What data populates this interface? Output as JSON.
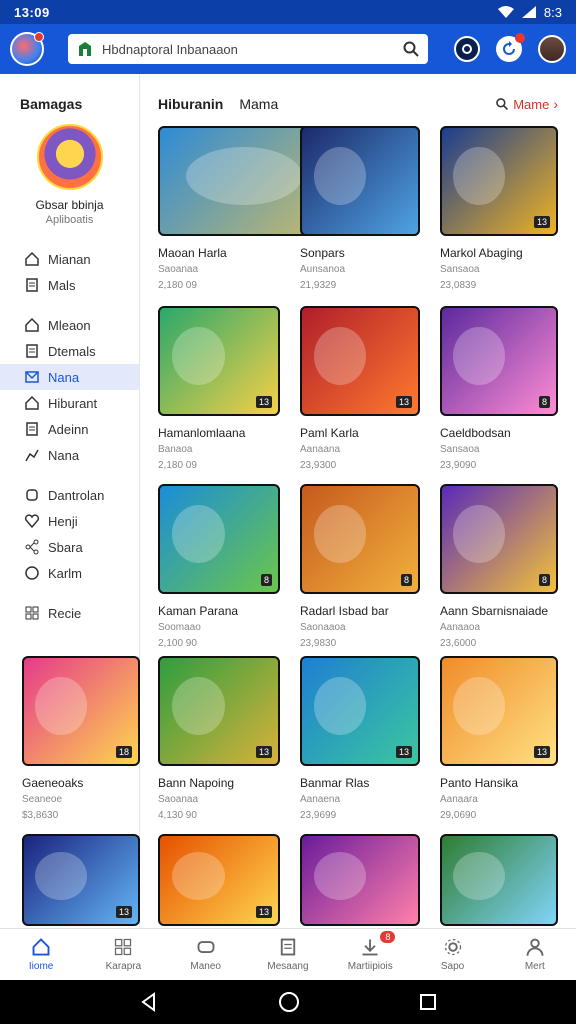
{
  "status": {
    "time": "13:09",
    "right": "8:3"
  },
  "search": {
    "value": "Hbdnaptoral Inbanaaon"
  },
  "sidebar": {
    "title": "Bamagas",
    "profile": {
      "name": "Gbsar bbinja",
      "sub": "Apliboatis"
    },
    "items": [
      {
        "label": "Mianan",
        "icon": "home-icon"
      },
      {
        "label": "Mals",
        "icon": "doc-icon"
      },
      {
        "label": "Mleaon",
        "icon": "home-icon"
      },
      {
        "label": "Dtemals",
        "icon": "doc-icon"
      },
      {
        "label": "Nana",
        "icon": "mail-icon",
        "active": true
      },
      {
        "label": "Hiburant",
        "icon": "home-icon"
      },
      {
        "label": "Adeinn",
        "icon": "doc-icon"
      },
      {
        "label": "Nana",
        "icon": "chart-icon"
      },
      {
        "label": "Dantrolan",
        "icon": "puzzle-icon"
      },
      {
        "label": "Henji",
        "icon": "heart-icon"
      },
      {
        "label": "Sbara",
        "icon": "share-icon"
      },
      {
        "label": "Karlm",
        "icon": "circle-icon"
      },
      {
        "label": "Recie",
        "icon": "grid-icon"
      }
    ]
  },
  "section": {
    "tab1": "Hiburanin",
    "tab2": "Mama",
    "more": "Mame"
  },
  "cards": [
    {
      "title": "Maoan Harla",
      "meta": "Saoanaa",
      "size": "2,180 09",
      "tag": "",
      "colors": [
        "#2e8bd6",
        "#f7c948"
      ]
    },
    {
      "title": "Sonpars",
      "meta": "Aunsanoa",
      "size": "21,9329",
      "tag": "",
      "colors": [
        "#1c2a6b",
        "#4fa3e3"
      ]
    },
    {
      "title": "Markol Abaging",
      "meta": "Sansaoa",
      "size": "23,0839",
      "tag": "13",
      "colors": [
        "#1b3d8f",
        "#f0b323"
      ]
    },
    {
      "title": "Hamanlomlaana",
      "meta": "Banaoa",
      "size": "2,180 09",
      "tag": "13",
      "colors": [
        "#2aa86b",
        "#f7d046"
      ]
    },
    {
      "title": "Paml Karla",
      "meta": "Aanaana",
      "size": "23,9300",
      "tag": "13",
      "colors": [
        "#b11e2b",
        "#ff7a2e"
      ]
    },
    {
      "title": "Caeldbodsan",
      "meta": "Sansaoa",
      "size": "23,9090",
      "tag": "8",
      "colors": [
        "#5b2a9e",
        "#ff8cd4"
      ]
    },
    {
      "title": "Kaman Parana",
      "meta": "Soomaao",
      "size": "2,100 90",
      "tag": "8",
      "colors": [
        "#1a8dd8",
        "#6cc64a"
      ]
    },
    {
      "title": "Radarl Isbad bar",
      "meta": "Saonaaoa",
      "size": "23,9830",
      "tag": "8",
      "colors": [
        "#c65a1e",
        "#f2b13d"
      ]
    },
    {
      "title": "Aann Sbarnisnaiade",
      "meta": "Aanaaoa",
      "size": "23,6000",
      "tag": "8",
      "colors": [
        "#5a2ab8",
        "#f3c13a"
      ]
    },
    {
      "title": "Gaeneoaks",
      "meta": "Seaneoe",
      "size": "$3,8630",
      "tag": "18",
      "colors": [
        "#e53b8a",
        "#ffd54f"
      ]
    },
    {
      "title": "Bann Napoing",
      "meta": "Saoanaa",
      "size": "4,130 90",
      "tag": "13",
      "colors": [
        "#2e9e3f",
        "#d9b23a"
      ]
    },
    {
      "title": "Banmar Rlas",
      "meta": "Aanaena",
      "size": "23,9699",
      "tag": "13",
      "colors": [
        "#1f7fd1",
        "#3bc7a0"
      ]
    },
    {
      "title": "Panto Hansika",
      "meta": "Aanaara",
      "size": "29,0690",
      "tag": "13",
      "colors": [
        "#f08c2a",
        "#ffe082"
      ]
    },
    {
      "title": "",
      "meta": "",
      "size": "",
      "tag": "13",
      "colors": [
        "#1a237e",
        "#64b5f6"
      ]
    },
    {
      "title": "",
      "meta": "",
      "size": "",
      "tag": "13",
      "colors": [
        "#e65100",
        "#ffd54f"
      ]
    },
    {
      "title": "",
      "meta": "",
      "size": "",
      "tag": "",
      "colors": [
        "#6a1b9a",
        "#ff80ab"
      ]
    },
    {
      "title": "",
      "meta": "",
      "size": "",
      "tag": "",
      "colors": [
        "#2e7d32",
        "#81d4fa"
      ]
    }
  ],
  "bottomnav": [
    {
      "label": "Iiome",
      "icon": "home-icon",
      "active": true
    },
    {
      "label": "Karapra",
      "icon": "grid-icon"
    },
    {
      "label": "Maneo",
      "icon": "game-icon"
    },
    {
      "label": "Mesaang",
      "icon": "doc-icon"
    },
    {
      "label": "Martiipiois",
      "icon": "download-icon",
      "count": "8"
    },
    {
      "label": "Sapo",
      "icon": "gear-icon"
    },
    {
      "label": "Mert",
      "icon": "person-icon"
    }
  ]
}
